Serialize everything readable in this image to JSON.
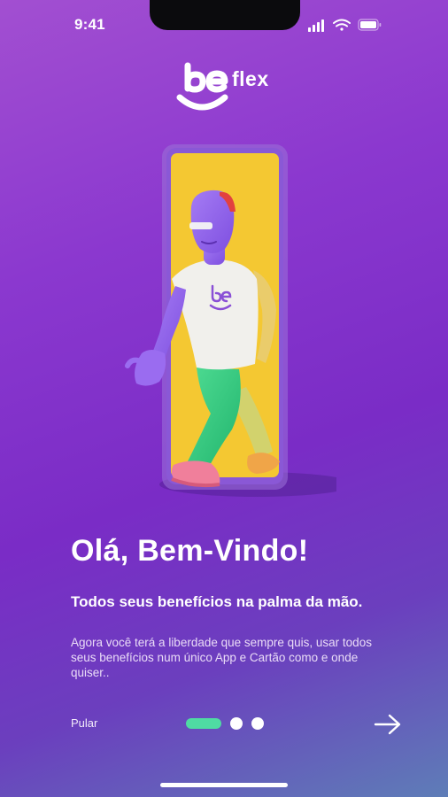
{
  "status_bar": {
    "time": "9:41",
    "icons": [
      "cellular-signal-icon",
      "wifi-icon",
      "battery-icon"
    ]
  },
  "brand": {
    "logo_text": "be",
    "logo_suffix": "flex"
  },
  "onboarding": {
    "title": "Olá, Bem-Vindo!",
    "subtitle": "Todos seus benefícios na palma da mão.",
    "description": "Agora você terá a liberdade que sempre quis, usar todos seus benefícios num único App e Cartão como e onde quiser..",
    "skip_label": "Pular",
    "next_icon": "arrow-right-icon",
    "pagination": {
      "total": 3,
      "current": 1
    }
  },
  "colors": {
    "gradient_start": "#a24fd1",
    "gradient_end": "#5e7db7",
    "accent": "#4fdba3",
    "phone_screen": "#f4c832"
  }
}
